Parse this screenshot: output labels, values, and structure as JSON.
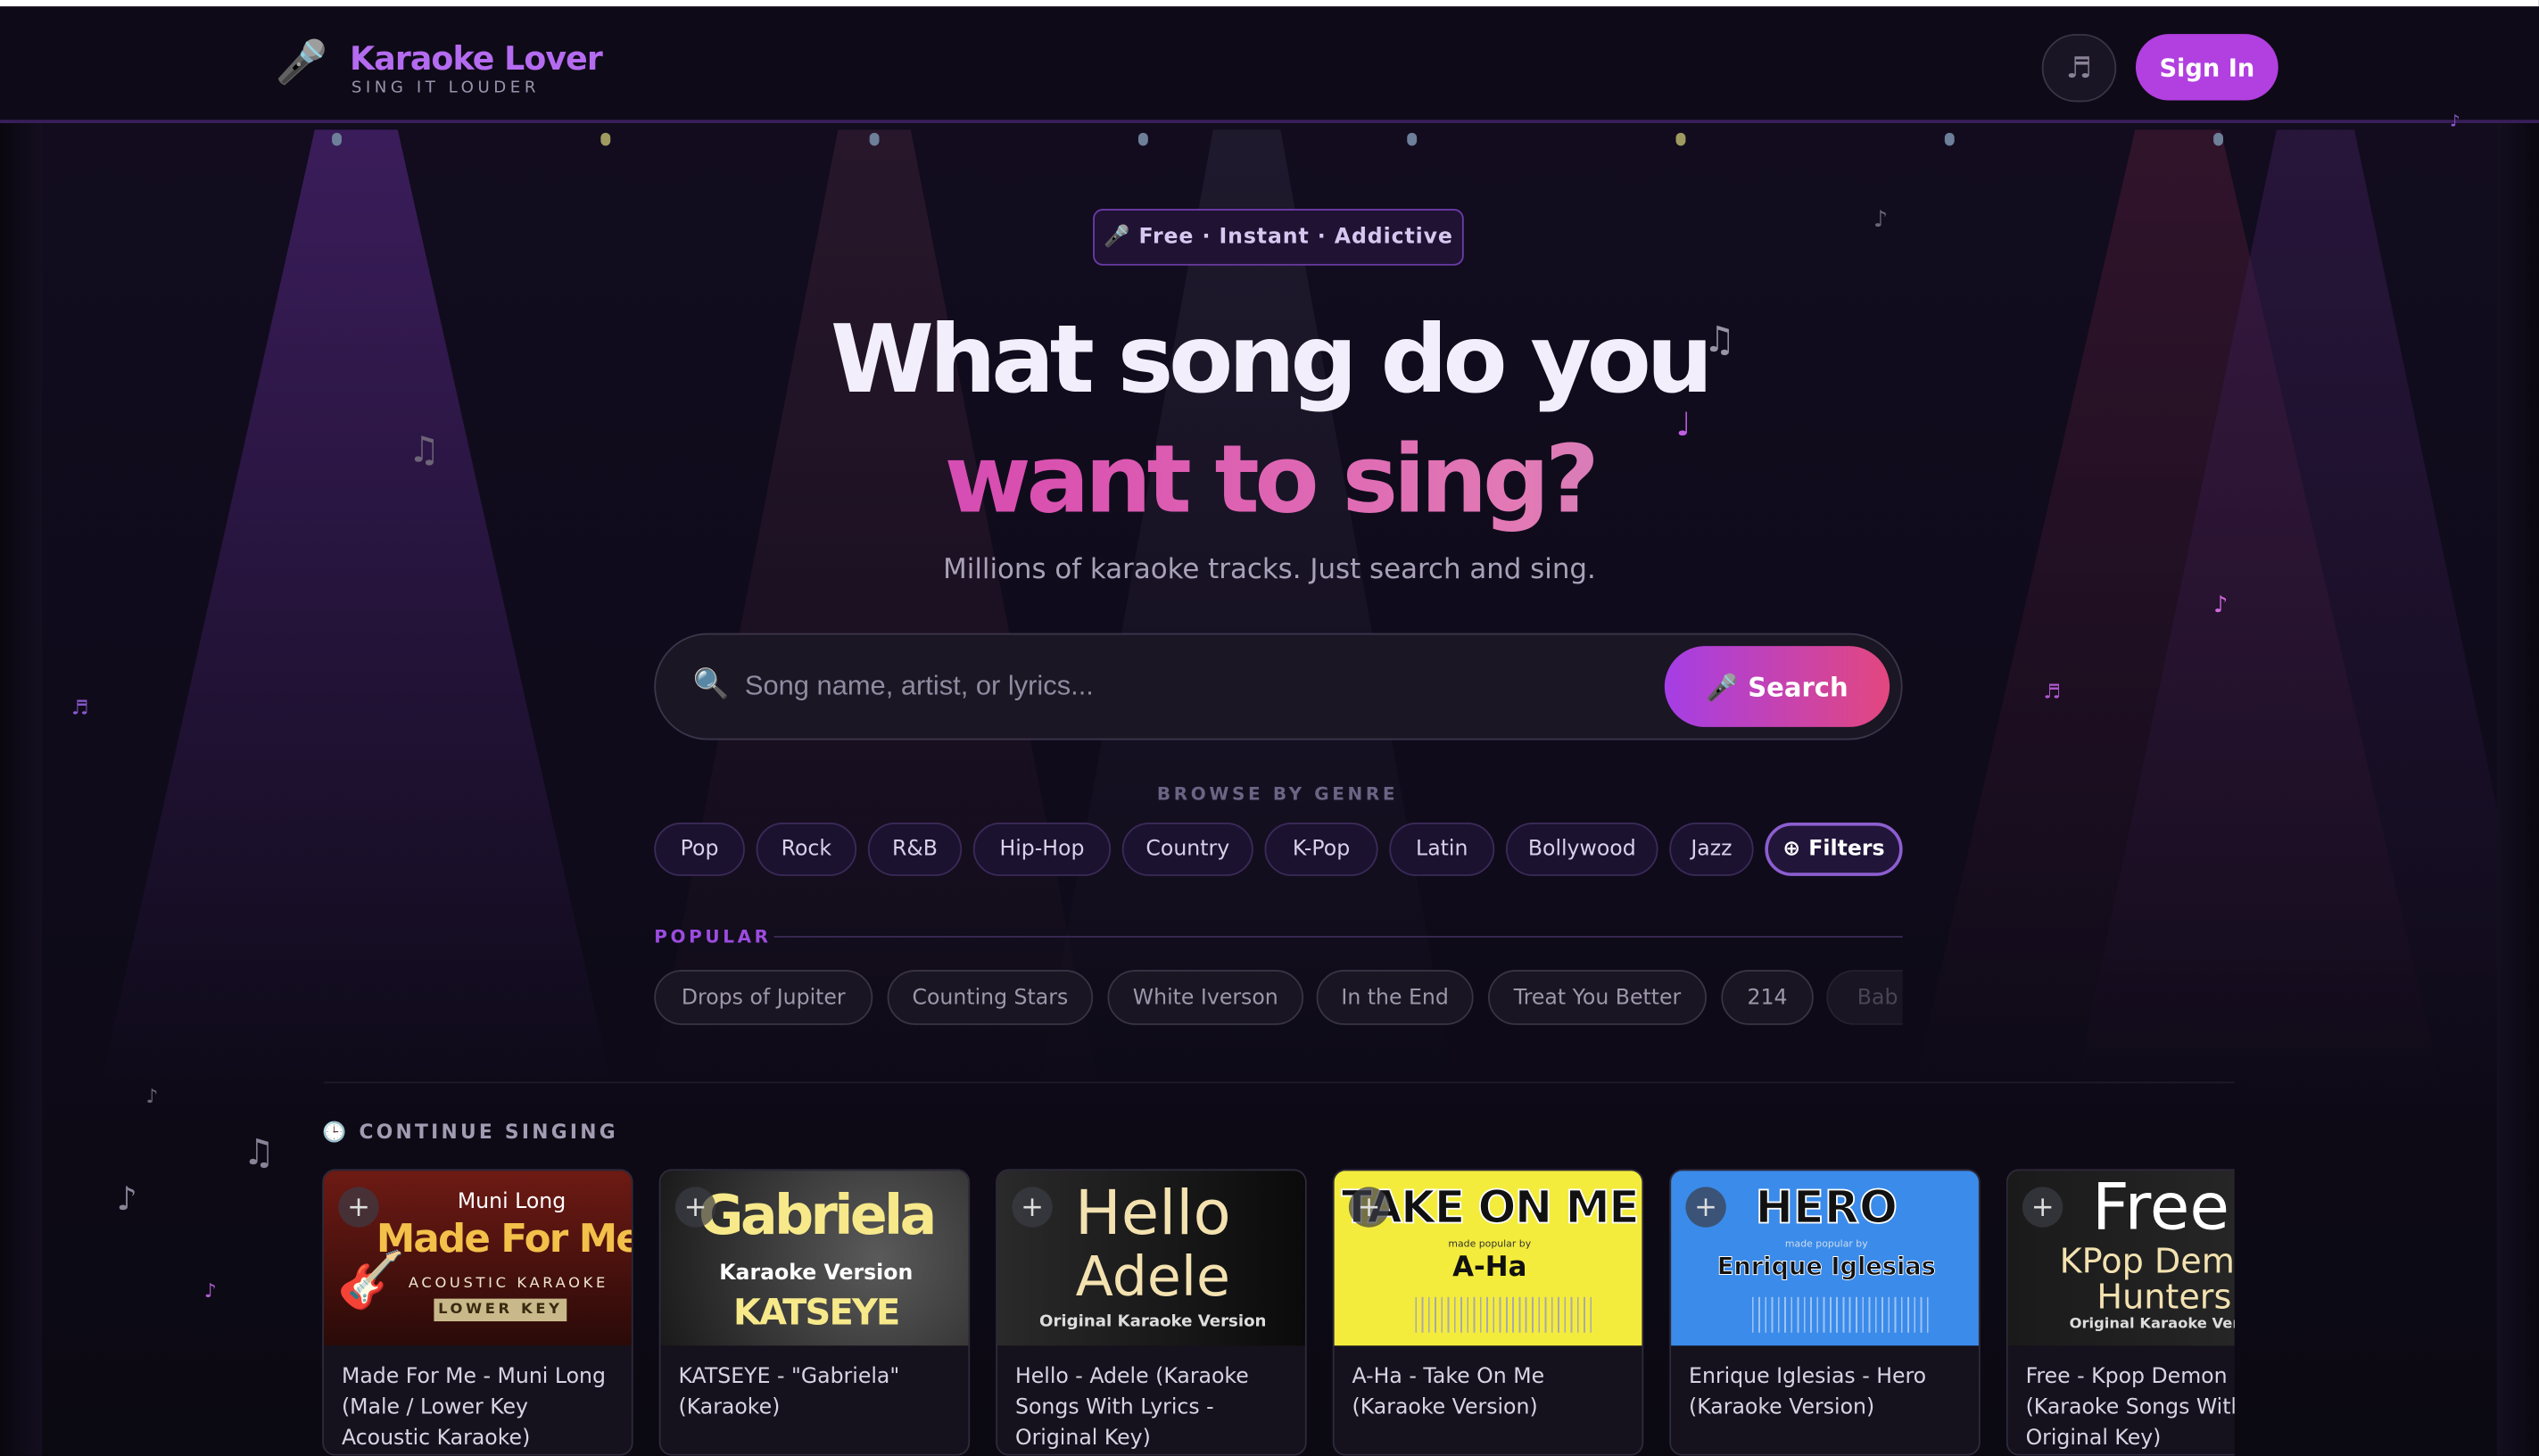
{
  "header": {
    "logo_title": "Karaoke Lover",
    "logo_subtitle": "SING IT LOUDER",
    "music_icon": "music-note-icon",
    "sign_in_label": "Sign In"
  },
  "hero": {
    "badge": "🎤 Free · Instant · Addictive",
    "title_line1": "What song do you",
    "title_line2": "want to sing?",
    "subtitle": "Millions of karaoke tracks. Just search and sing."
  },
  "search": {
    "placeholder": "Song name, artist, or lyrics...",
    "value": "",
    "button_label": "Search"
  },
  "genres": {
    "heading": "BROWSE BY GENRE",
    "items": [
      "Pop",
      "Rock",
      "R&B",
      "Hip-Hop",
      "Country",
      "K-Pop",
      "Latin",
      "Bollywood",
      "Jazz"
    ],
    "filters_label": "Filters"
  },
  "popular": {
    "heading": "POPULAR",
    "items": [
      "Drops of Jupiter",
      "Counting Stars",
      "White Iverson",
      "In the End",
      "Treat You Better",
      "214",
      "Bab"
    ]
  },
  "continue": {
    "heading": "CONTINUE SINGING",
    "cards": [
      {
        "title": "Made For Me - Muni Long (Male / Lower Key Acoustic Karaoke)",
        "thumb": {
          "l1": "Muni Long",
          "l2": "Made For Me",
          "l3": "ACOUSTIC KARAOKE",
          "l4": "LOWER KEY"
        }
      },
      {
        "title": "KATSEYE - \"Gabriela\" (Karaoke)",
        "thumb": {
          "l1": "Gabriela",
          "l2": "Karaoke Version",
          "l3": "KATSEYE"
        }
      },
      {
        "title": "Hello - Adele (Karaoke Songs With Lyrics - Original Key)",
        "thumb": {
          "l1": "Hello",
          "l2": "Adele",
          "l3": "Original Karaoke Version"
        }
      },
      {
        "title": "A-Ha - Take On Me (Karaoke Version)",
        "thumb": {
          "l1": "TAKE ON ME",
          "l2": "made popular by",
          "l3": "A-Ha"
        }
      },
      {
        "title": "Enrique Iglesias - Hero (Karaoke Version)",
        "thumb": {
          "l1": "HERO",
          "l2": "made popular by",
          "l3": "Enrique Iglesias"
        }
      },
      {
        "title": "Free - Kpop Demon H (Karaoke Songs With I Original Key)",
        "thumb": {
          "l1": "Free",
          "l2": "KPop Demo",
          "l3": "Hunters",
          "l4": "Original Karaoke Vers"
        }
      }
    ]
  },
  "colors": {
    "accent": "#b23fe0",
    "background": "#0f0b1a",
    "gradient_start": "#a13ef0",
    "gradient_end": "#5a9ad8"
  }
}
